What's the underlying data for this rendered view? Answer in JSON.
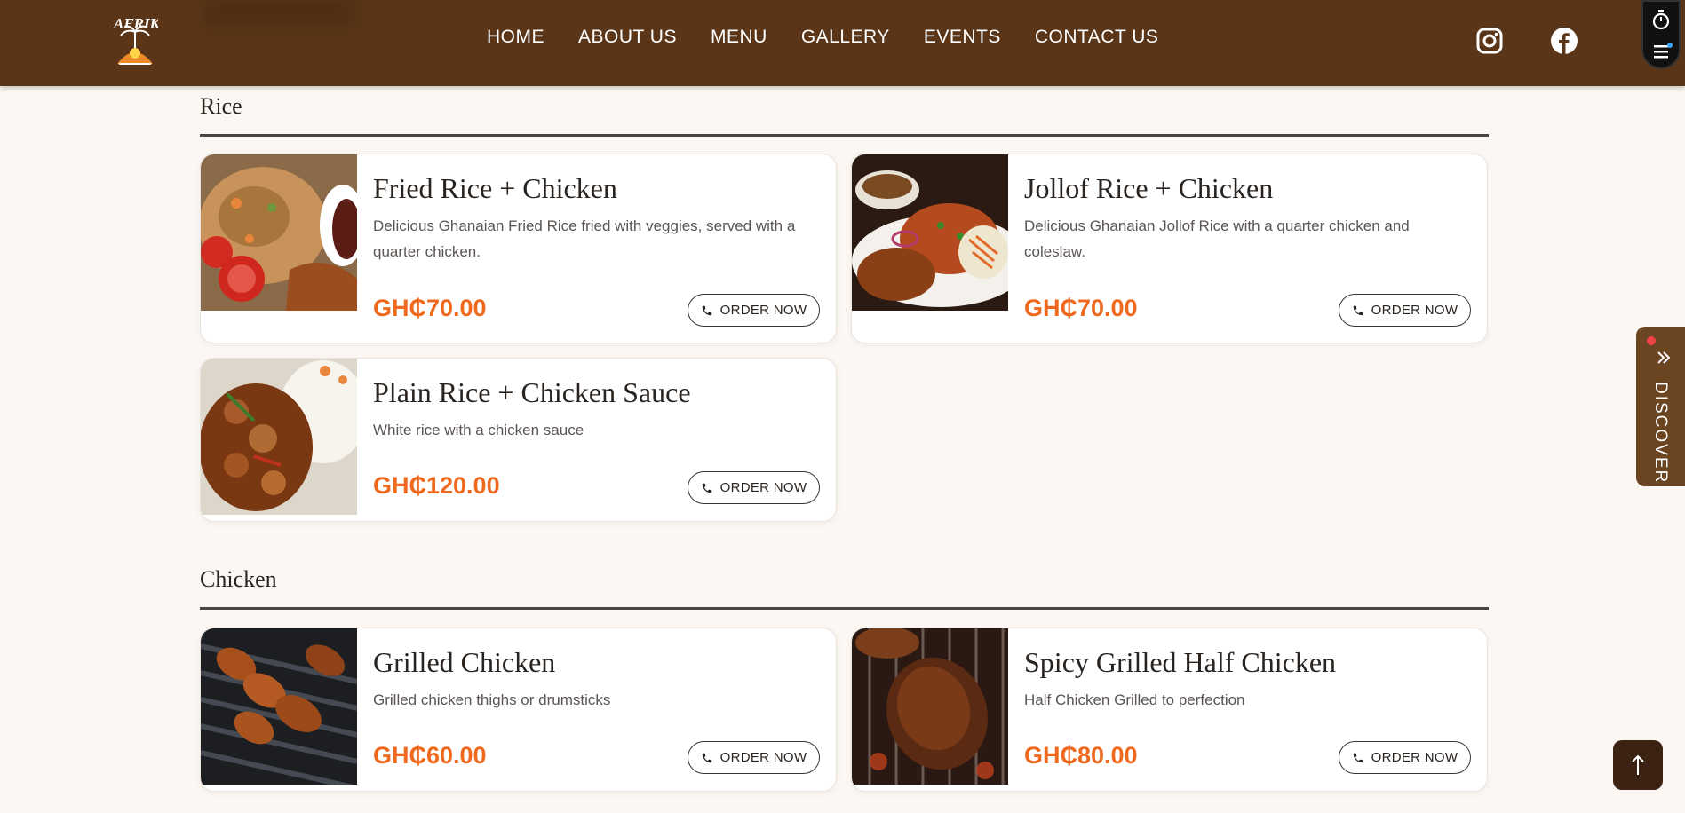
{
  "header": {
    "logo_text": "AFRIK",
    "nav": [
      "HOME",
      "ABOUT US",
      "MENU",
      "GALLERY",
      "EVENTS",
      "CONTACT US"
    ],
    "social": [
      "instagram-icon",
      "facebook-icon"
    ]
  },
  "colors": {
    "header": "#5a3518",
    "price": "#ef6a1f",
    "background": "#fcf7f2"
  },
  "sections": [
    {
      "title": "Rice",
      "items": [
        {
          "name": "Fried Rice + Chicken",
          "desc": "Delicious Ghanaian Fried Rice fried with veggies, served with a quarter chicken.",
          "price": "GH₵70.00",
          "order": "ORDER NOW"
        },
        {
          "name": "Jollof Rice + Chicken",
          "desc": "Delicious Ghanaian Jollof Rice with a quarter chicken and coleslaw.",
          "price": "GH₵70.00",
          "order": "ORDER NOW"
        },
        {
          "name": "Plain Rice + Chicken Sauce",
          "desc": "White rice with a chicken sauce",
          "price": "GH₵120.00",
          "order": "ORDER NOW"
        }
      ]
    },
    {
      "title": "Chicken",
      "items": [
        {
          "name": "Grilled Chicken",
          "desc": "Grilled chicken thighs or drumsticks",
          "price": "GH₵60.00",
          "order": "ORDER NOW"
        },
        {
          "name": "Spicy Grilled Half Chicken",
          "desc": "Half Chicken Grilled to perfection",
          "price": "GH₵80.00",
          "order": "ORDER NOW"
        }
      ]
    }
  ],
  "discover": {
    "label": "DISCOVER"
  }
}
